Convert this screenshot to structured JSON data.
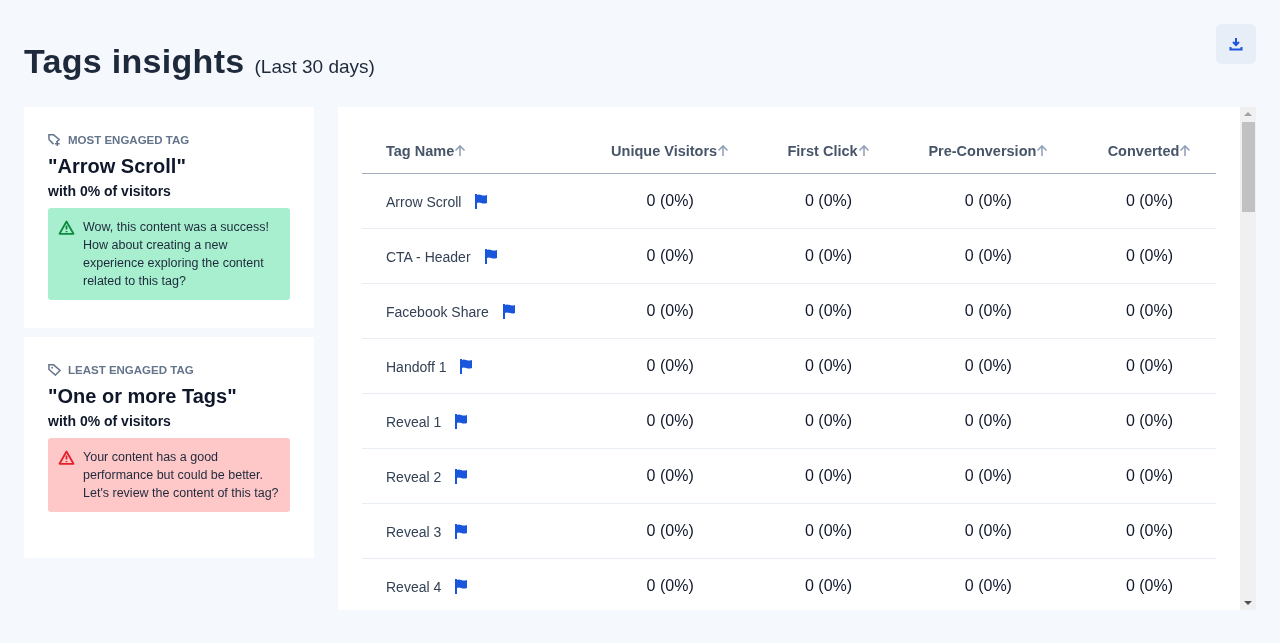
{
  "header": {
    "title": "Tags insights",
    "subtitle": "(Last 30 days)"
  },
  "insights": [
    {
      "kind": "most",
      "label": "MOST ENGAGED TAG",
      "tag": "\"Arrow Scroll\"",
      "share": "with 0% of visitors",
      "message": "Wow, this content was a success! How about creating a new experience exploring the content related to this tag?"
    },
    {
      "kind": "least",
      "label": "LEAST ENGAGED TAG",
      "tag": "\"One or more Tags\"",
      "share": "with 0% of visitors",
      "message": "Your content has a good performance but could be better. Let's review the content of this tag?"
    }
  ],
  "table": {
    "columns": [
      "Tag Name",
      "Unique Visitors",
      "First Click",
      "Pre-Conversion",
      "Converted"
    ],
    "rows": [
      [
        "Arrow Scroll",
        "0 (0%)",
        "0 (0%)",
        "0 (0%)",
        "0 (0%)"
      ],
      [
        "CTA - Header",
        "0 (0%)",
        "0 (0%)",
        "0 (0%)",
        "0 (0%)"
      ],
      [
        "Facebook Share",
        "0 (0%)",
        "0 (0%)",
        "0 (0%)",
        "0 (0%)"
      ],
      [
        "Handoff 1",
        "0 (0%)",
        "0 (0%)",
        "0 (0%)",
        "0 (0%)"
      ],
      [
        "Reveal 1",
        "0 (0%)",
        "0 (0%)",
        "0 (0%)",
        "0 (0%)"
      ],
      [
        "Reveal 2",
        "0 (0%)",
        "0 (0%)",
        "0 (0%)",
        "0 (0%)"
      ],
      [
        "Reveal 3",
        "0 (0%)",
        "0 (0%)",
        "0 (0%)",
        "0 (0%)"
      ],
      [
        "Reveal 4",
        "0 (0%)",
        "0 (0%)",
        "0 (0%)",
        "0 (0%)"
      ]
    ]
  }
}
